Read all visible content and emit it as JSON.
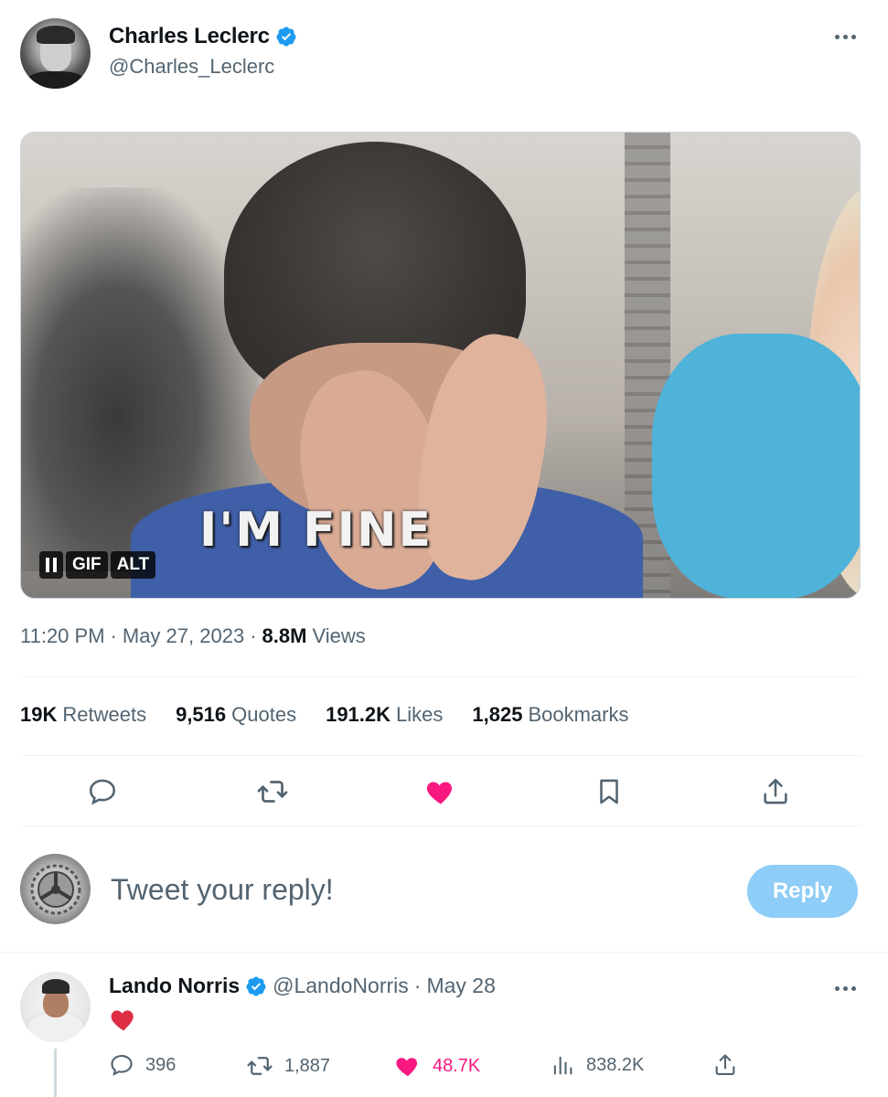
{
  "tweet": {
    "author": {
      "display_name": "Charles Leclerc",
      "handle": "@Charles_Leclerc",
      "verified": true
    },
    "media": {
      "caption": "I'M FINE",
      "badge_gif": "GIF",
      "badge_alt": "ALT"
    },
    "time": "11:20 PM",
    "separator": "·",
    "date": "May 27, 2023",
    "views_count": "8.8M",
    "views_label": "Views",
    "stats": {
      "retweets_count": "19K",
      "retweets_label": "Retweets",
      "quotes_count": "9,516",
      "quotes_label": "Quotes",
      "likes_count": "191.2K",
      "likes_label": "Likes",
      "bookmarks_count": "1,825",
      "bookmarks_label": "Bookmarks"
    },
    "liked": true
  },
  "reply_composer": {
    "placeholder": "Tweet your reply!",
    "button_label": "Reply"
  },
  "reply": {
    "display_name": "Lando Norris",
    "handle": "@LandoNorris",
    "separator": "·",
    "date": "May 28",
    "body_emoji": "red-heart",
    "replies": "396",
    "retweets": "1,887",
    "likes": "48.7K",
    "views": "838.2K",
    "liked": true
  },
  "colors": {
    "verified_blue": "#1d9bf0",
    "like_pink": "#f91880",
    "secondary_text": "#536471",
    "reply_button": "#8ecdf7"
  }
}
